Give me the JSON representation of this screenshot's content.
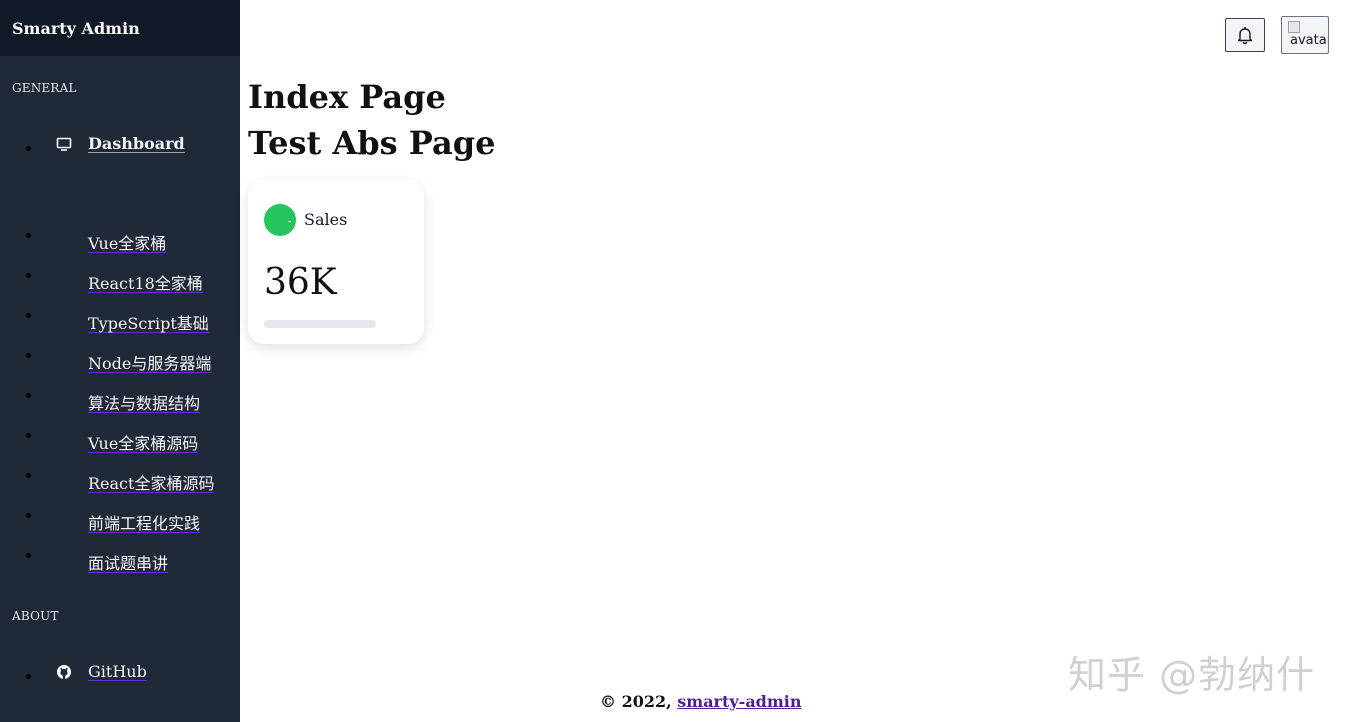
{
  "sidebar": {
    "brand": "Smarty Admin",
    "sections": {
      "general": "GENERAL",
      "about": "ABOUT"
    },
    "dashboard_label": "Dashboard",
    "items": [
      {
        "label": "Vue全家桶"
      },
      {
        "label": "React18全家桶"
      },
      {
        "label": "TypeScript基础"
      },
      {
        "label": "Node与服务器端"
      },
      {
        "label": "算法与数据结构"
      },
      {
        "label": "Vue全家桶源码"
      },
      {
        "label": "React全家桶源码"
      },
      {
        "label": "前端工程化实践"
      },
      {
        "label": "面试题串讲"
      }
    ],
    "github_label": "GitHub"
  },
  "header": {
    "bell_icon": "bell-icon",
    "avatar_alt": "avatar"
  },
  "main": {
    "headings": [
      "Index Page",
      "Test Abs Page"
    ],
    "card": {
      "label": "Sales",
      "value": "36K",
      "accent": "#22c55e",
      "progress": 0
    }
  },
  "footer": {
    "prefix": "© 2022, ",
    "link_text": "smarty-admin"
  },
  "watermark": "知乎 @勃纳什",
  "colors": {
    "sidebar_bg": "#1f2937",
    "brand_bg": "#111827",
    "link_purple": "#4c1d95"
  }
}
